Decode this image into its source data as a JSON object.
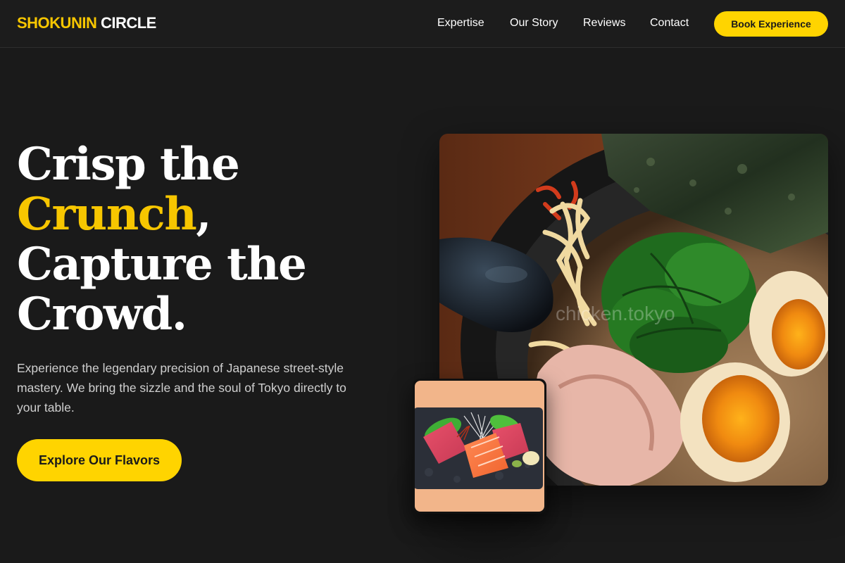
{
  "brand": {
    "part1": "SHOKUNIN",
    "part2": "CIRCLE",
    "accent_color": "#f7c600"
  },
  "nav": {
    "links": [
      {
        "label": "Expertise"
      },
      {
        "label": "Our Story"
      },
      {
        "label": "Reviews"
      },
      {
        "label": "Contact"
      }
    ],
    "cta_label": "Book Experience"
  },
  "hero": {
    "title_line1": "Crisp the",
    "title_highlight": "Crunch",
    "title_comma": ",",
    "title_line3": "Capture the",
    "title_line4": "Crowd.",
    "description": "Experience the legendary precision of Japanese street-style mastery. We bring the sizzle and the soul of Tokyo directly to your table.",
    "cta_label": "Explore Our Flavors"
  },
  "images": {
    "main": {
      "watermark": "chicken.tokyo"
    }
  },
  "colors": {
    "background": "#1a1a1a",
    "accent": "#ffd400",
    "text": "#ffffff",
    "muted_text": "#cfcfcf"
  }
}
